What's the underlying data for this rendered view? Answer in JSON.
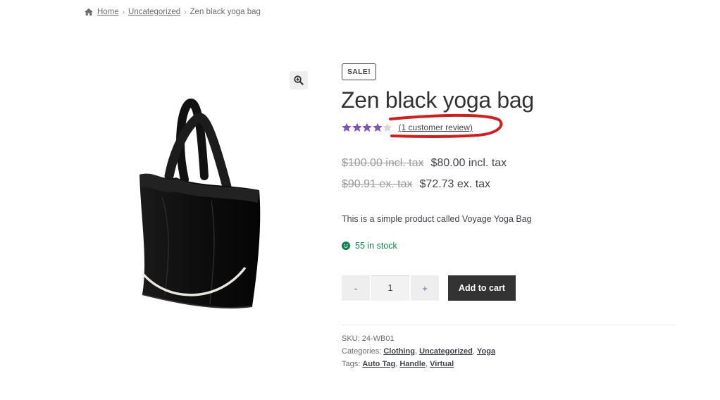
{
  "breadcrumb": {
    "items": [
      {
        "label": "Home"
      },
      {
        "label": "Uncategorized"
      },
      {
        "label": "Zen black yoga bag"
      }
    ],
    "separator": "›"
  },
  "gallery": {
    "zoom_icon": "magnifier-plus-icon",
    "image_subject": "black-tote-bag"
  },
  "product": {
    "badge": "SALE!",
    "title": "Zen black yoga bag",
    "rating": {
      "value": 4,
      "max": 5,
      "review_label": "(1 customer review)",
      "star_color": "#7f54b3"
    },
    "prices": [
      {
        "old": "$100.00 incl. tax",
        "new": "$80.00 incl. tax"
      },
      {
        "old": "$90.91 ex. tax",
        "new": "$72.73 ex. tax"
      }
    ],
    "description": "This is a simple product called Voyage Yoga Bag",
    "stock": {
      "label": "55 in stock",
      "color": "#0f834d"
    },
    "quantity": {
      "minus": "-",
      "value": "1",
      "plus": "+"
    },
    "add_to_cart": "Add to cart",
    "meta": {
      "sku_label": "SKU:",
      "sku": "24-WB01",
      "categories_label": "Categories:",
      "categories": [
        "Clothing",
        "Uncategorized",
        "Yoga"
      ],
      "tags_label": "Tags:",
      "tags": [
        "Auto Tag",
        "Handle",
        "Virtual"
      ]
    }
  },
  "annotation": {
    "color": "#cc1f1f"
  }
}
